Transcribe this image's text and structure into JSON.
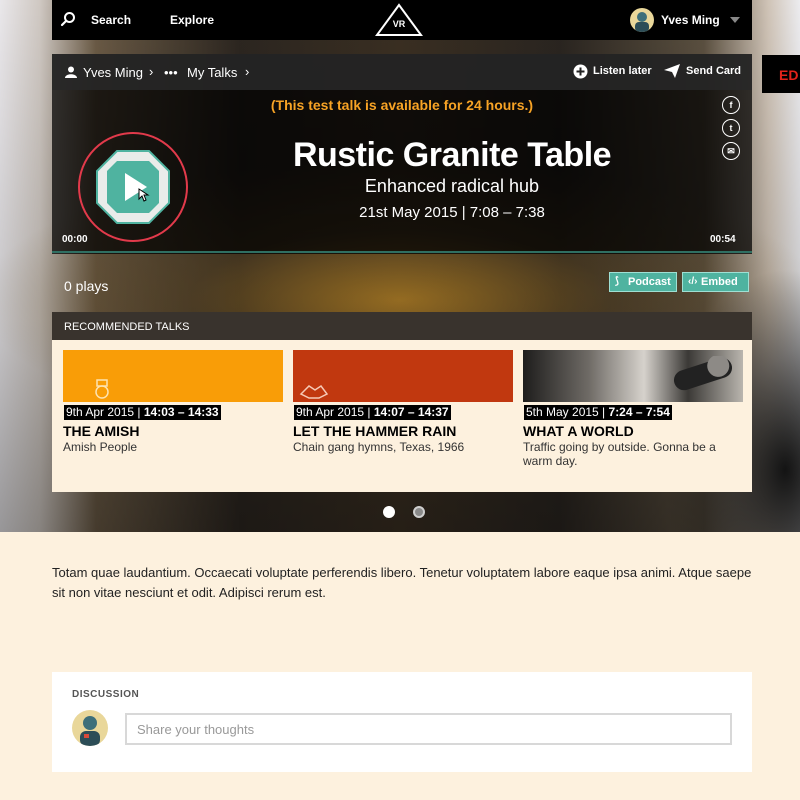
{
  "nav": {
    "search_label": "Search",
    "explore_label": "Explore",
    "logo_text": "VR",
    "user_name": "Yves Ming"
  },
  "side_badge": "ED",
  "player": {
    "breadcrumb": [
      "Yves Ming",
      "•••",
      "My Talks"
    ],
    "listen_later": "Listen later",
    "send_card": "Send Card",
    "notice": "(This test talk is available for 24 hours.)",
    "title": "Rustic Granite Table",
    "subtitle": "Enhanced radical hub",
    "date": "21st May 2015 | 7:08 – 7:38",
    "time_start": "00:00",
    "time_end": "00:54",
    "progress": 0,
    "social": [
      "f",
      "t",
      "✉"
    ]
  },
  "plays": {
    "count": "0 plays",
    "podcast_label": "Podcast",
    "embed_label": "Embed"
  },
  "recommended": {
    "heading": "RECOMMENDED TALKS",
    "cards": [
      {
        "date": "9th Apr 2015",
        "time": "14:03 – 14:33",
        "title": "THE AMISH",
        "desc": "Amish People",
        "color": "#f99d07"
      },
      {
        "date": "9th Apr 2015",
        "time": "14:07 – 14:37",
        "title": "LET THE HAMMER RAIN",
        "desc": "Chain gang hymns, Texas, 1966",
        "color": "#c1380f"
      },
      {
        "date": "5th May 2015",
        "time": "7:24 – 7:54",
        "title": "WHAT A WORLD",
        "desc": "Traffic going by outside. Gonna be a warm day.",
        "color": "#8f8c88"
      }
    ]
  },
  "description": "Totam quae laudantium. Occaecati voluptate perferendis libero. Tenetur voluptatem labore eaque ipsa animi. Atque saepe sit non vitae nesciunt et odit. Adipisci rerum est.",
  "discussion": {
    "label": "DISCUSSION",
    "placeholder": "Share your thoughts"
  },
  "colors": {
    "accent": "#4fb3a0",
    "notice": "#f7a325",
    "play_ring": "#e23a4b"
  }
}
